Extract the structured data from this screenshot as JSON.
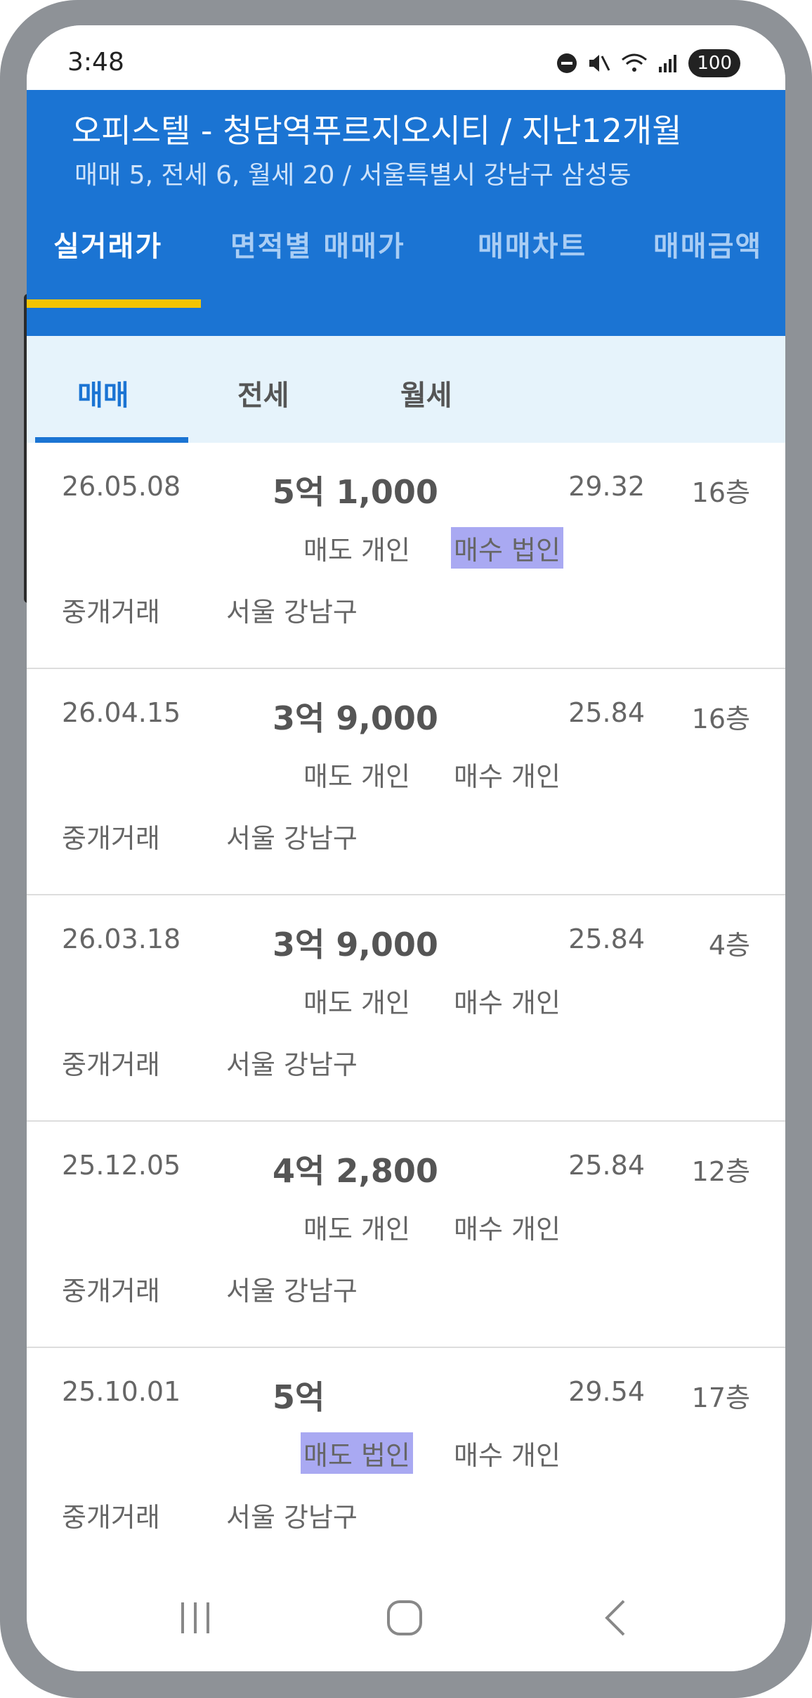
{
  "status_bar": {
    "time": "3:48",
    "battery": "100"
  },
  "header": {
    "title": "오피스텔 - 청담역푸르지오시티 / 지난12개월",
    "subtitle": "매매 5, 전세 6, 월세 20 / 서울특별시 강남구 삼성동"
  },
  "tabs": [
    {
      "label": "실거래가",
      "active": true
    },
    {
      "label": "면적별 매매가"
    },
    {
      "label": "매매차트"
    },
    {
      "label": "매매금액"
    }
  ],
  "subtabs": [
    {
      "label": "매매",
      "active": true
    },
    {
      "label": "전세"
    },
    {
      "label": "월세"
    }
  ],
  "transactions": [
    {
      "date": "26.05.08",
      "price": "5억 1,000",
      "area": "29.32",
      "floor": "16층",
      "seller": "매도 개인",
      "buyer": "매수 법인",
      "deal_type": "중개거래",
      "region": "서울 강남구"
    },
    {
      "date": "26.04.15",
      "price": "3억 9,000",
      "area": "25.84",
      "floor": "16층",
      "seller": "매도 개인",
      "buyer": "매수 개인",
      "deal_type": "중개거래",
      "region": "서울 강남구"
    },
    {
      "date": "26.03.18",
      "price": "3억 9,000",
      "area": "25.84",
      "floor": "4층",
      "seller": "매도 개인",
      "buyer": "매수 개인",
      "deal_type": "중개거래",
      "region": "서울 강남구"
    },
    {
      "date": "25.12.05",
      "price": "4억 2,800",
      "area": "25.84",
      "floor": "12층",
      "seller": "매도 개인",
      "buyer": "매수 개인",
      "deal_type": "중개거래",
      "region": "서울 강남구"
    },
    {
      "date": "25.10.01",
      "price": "5억",
      "area": "29.54",
      "floor": "17층",
      "seller": "매도 법인",
      "buyer": "매수 개인",
      "deal_type": "중개거래",
      "region": "서울 강남구"
    }
  ],
  "colors": {
    "header_bg": "#1b74d3",
    "tab_indicator": "#f3c400",
    "subtab_bg": "#e6f3fb",
    "highlight": "#a9a9f2"
  }
}
